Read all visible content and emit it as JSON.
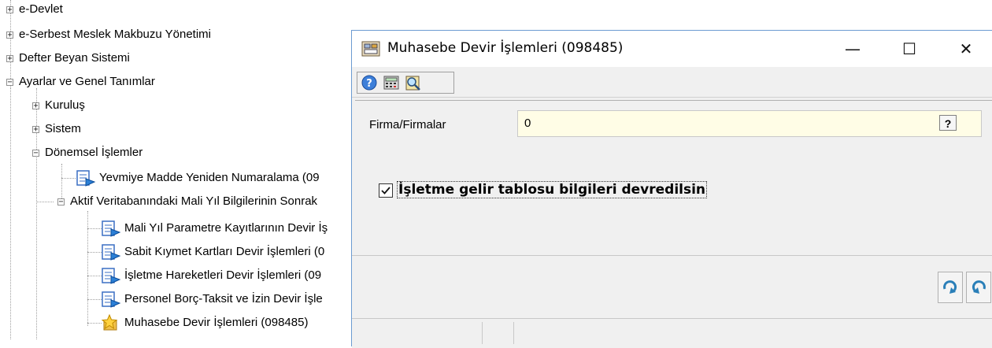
{
  "tree": {
    "items": [
      {
        "label": "e-Devlet"
      },
      {
        "label": "e-Serbest Meslek Makbuzu Yönetimi"
      },
      {
        "label": "Defter Beyan Sistemi"
      },
      {
        "label": "Ayarlar ve Genel Tanımlar"
      },
      {
        "label": "Kuruluş"
      },
      {
        "label": "Sistem"
      },
      {
        "label": "Dönemsel İşlemler"
      },
      {
        "label": "Yevmiye Madde Yeniden Numaralama (09"
      },
      {
        "label": "Aktif Veritabanındaki Mali Yıl Bilgilerinin Sonrak"
      },
      {
        "label": "Mali Yıl Parametre Kayıtlarının Devir İş"
      },
      {
        "label": "Sabit Kıymet Kartları Devir İşlemleri (0"
      },
      {
        "label": "İşletme Hareketleri Devir İşlemleri (09"
      },
      {
        "label": "Personel Borç-Taksit ve İzin Devir İşle"
      },
      {
        "label": "Muhasebe Devir İşlemleri (098485)"
      }
    ]
  },
  "dialog": {
    "title": "Muhasebe Devir İşlemleri (098485)",
    "minimize_glyph": "—",
    "maximize_glyph": "☐",
    "close_glyph": "✕",
    "firm_label": "Firma/Firmalar",
    "firm_value": "0",
    "lookup_label": "?",
    "checkbox_label": "İşletme gelir tablosu bilgileri devredilsin",
    "checkbox_checked": true
  }
}
